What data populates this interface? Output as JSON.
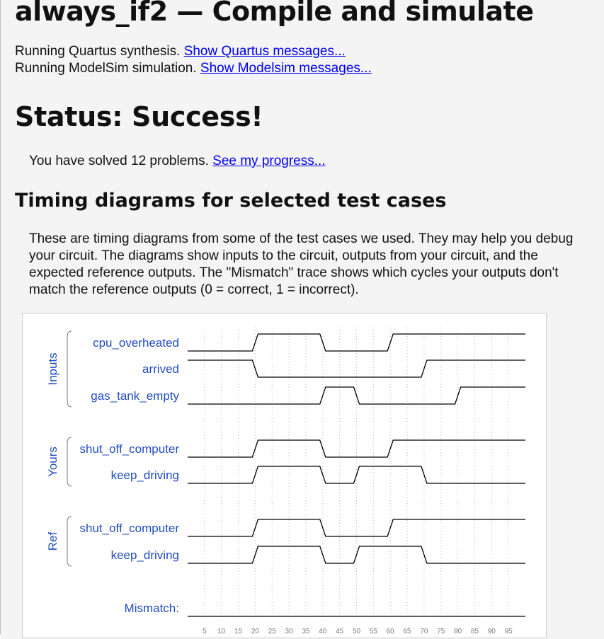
{
  "header": {
    "title": "always_if2 — Compile and simulate"
  },
  "compile": {
    "quartus_text": "Running Quartus synthesis.",
    "quartus_link": "Show Quartus messages...",
    "modelsim_text": "Running ModelSim simulation.",
    "modelsim_link": "Show Modelsim messages..."
  },
  "status": {
    "heading": "Status: Success!",
    "solved_text": "You have solved 12 problems.",
    "progress_link": "See my progress..."
  },
  "timing": {
    "heading": "Timing diagrams for selected test cases",
    "description": "These are timing diagrams from some of the test cases we used. They may help you debug your circuit. The diagrams show inputs to the circuit, outputs from your circuit, and the expected reference outputs. The \"Mismatch\" trace shows which cycles your outputs don't match the reference outputs (0 = correct, 1 = incorrect)."
  },
  "chart_data": {
    "type": "timing",
    "time_ticks": [
      5,
      10,
      15,
      20,
      25,
      30,
      35,
      40,
      45,
      50,
      55,
      60,
      65,
      70,
      75,
      80,
      85,
      90,
      95
    ],
    "time_range": [
      0,
      100
    ],
    "groups": [
      {
        "name": "Inputs",
        "signals": [
          "cpu_overheated",
          "arrived",
          "gas_tank_empty"
        ]
      },
      {
        "name": "Yours",
        "signals": [
          "shut_off_computer",
          "keep_driving"
        ]
      },
      {
        "name": "Ref",
        "signals": [
          "shut_off_computer",
          "keep_driving"
        ]
      }
    ],
    "series": [
      {
        "name": "cpu_overheated",
        "group": "Inputs",
        "values": [
          [
            0,
            0
          ],
          [
            20,
            1
          ],
          [
            40,
            0
          ],
          [
            60,
            1
          ]
        ]
      },
      {
        "name": "arrived",
        "group": "Inputs",
        "values": [
          [
            0,
            1
          ],
          [
            20,
            0
          ],
          [
            70,
            1
          ]
        ]
      },
      {
        "name": "gas_tank_empty",
        "group": "Inputs",
        "values": [
          [
            0,
            0
          ],
          [
            40,
            1
          ],
          [
            50,
            0
          ],
          [
            80,
            1
          ]
        ]
      },
      {
        "name": "shut_off_computer",
        "group": "Yours",
        "values": [
          [
            0,
            0
          ],
          [
            20,
            1
          ],
          [
            40,
            0
          ],
          [
            60,
            1
          ]
        ]
      },
      {
        "name": "keep_driving",
        "group": "Yours",
        "values": [
          [
            0,
            0
          ],
          [
            20,
            1
          ],
          [
            40,
            0
          ],
          [
            50,
            1
          ],
          [
            70,
            0
          ]
        ]
      },
      {
        "name": "shut_off_computer",
        "group": "Ref",
        "values": [
          [
            0,
            0
          ],
          [
            20,
            1
          ],
          [
            40,
            0
          ],
          [
            60,
            1
          ]
        ]
      },
      {
        "name": "keep_driving",
        "group": "Ref",
        "values": [
          [
            0,
            0
          ],
          [
            20,
            1
          ],
          [
            40,
            0
          ],
          [
            50,
            1
          ],
          [
            70,
            0
          ]
        ]
      },
      {
        "name": "Mismatch:",
        "group": "",
        "values": [
          [
            0,
            0
          ]
        ]
      }
    ],
    "colors": {
      "label": "#1f4cc0",
      "trace": "#000000",
      "grid": "#bbbbbb"
    }
  }
}
